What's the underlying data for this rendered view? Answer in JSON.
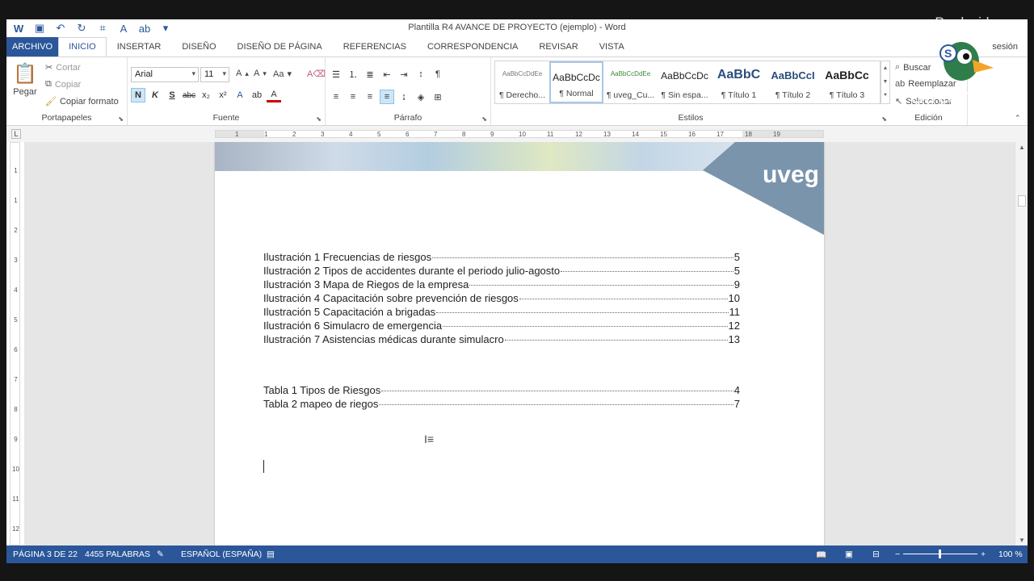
{
  "window_title": "Plantilla R4 AVANCE DE PROYECTO (ejemplo) - Word",
  "sign_in": "sesión",
  "tabs": [
    "ARCHIVO",
    "INICIO",
    "INSERTAR",
    "DISEÑO",
    "DISEÑO DE PÁGINA",
    "REFERENCIAS",
    "CORRESPONDENCIA",
    "REVISAR",
    "VISTA"
  ],
  "active_tab": "INICIO",
  "clipboard": {
    "paste": "Pegar",
    "cut": "Cortar",
    "copy": "Copiar",
    "format_painter": "Copiar formato",
    "label": "Portapapeles"
  },
  "font": {
    "name": "Arial",
    "size": "11",
    "case": "Aa",
    "bold": "N",
    "italic": "K",
    "underline": "S",
    "strike": "abc",
    "sub": "x₂",
    "sup": "x²",
    "label": "Fuente"
  },
  "paragraph": {
    "label": "Párrafo"
  },
  "styles": {
    "label": "Estilos",
    "items": [
      {
        "preview": "AaBbCcDdEe",
        "name": "¶ Derecho..."
      },
      {
        "preview": "AaBbCcDc",
        "name": "¶ Normal"
      },
      {
        "preview": "AaBbCcDdEe",
        "name": "¶ uveg_Cu..."
      },
      {
        "preview": "AaBbCcDc",
        "name": "¶ Sin espa..."
      },
      {
        "preview": "AaBbC",
        "name": "¶ Título 1"
      },
      {
        "preview": "AaBbCcI",
        "name": "¶ Título 2"
      },
      {
        "preview": "AaBbCc",
        "name": "¶ Título 3"
      }
    ]
  },
  "editing": {
    "find": "Buscar",
    "replace": "Reemplazar",
    "select": "Seleccionar",
    "label": "Edición"
  },
  "ruler_numbers": [
    "1",
    "1",
    "2",
    "3",
    "4",
    "5",
    "6",
    "7",
    "8",
    "9",
    "10",
    "11",
    "12",
    "13",
    "14",
    "15",
    "16",
    "17",
    "18",
    "19"
  ],
  "vruler_numbers": [
    "1",
    "1",
    "2",
    "3",
    "4",
    "5",
    "6",
    "7",
    "8",
    "9",
    "10",
    "11",
    "12"
  ],
  "logo_text": "uveg",
  "illustrations": [
    {
      "text": "Ilustración 1 Frecuencias de riesgos",
      "page": "5"
    },
    {
      "text": "Ilustración 2 Tipos de accidentes durante el periodo julio-agosto",
      "page": "5"
    },
    {
      "text": "Ilustración 3 Mapa de Riegos de la empresa",
      "page": "9"
    },
    {
      "text": "Ilustración 4 Capacitación sobre prevención de riesgos",
      "page": "10"
    },
    {
      "text": "Ilustración 5 Capacitación a brigadas",
      "page": "11"
    },
    {
      "text": "Ilustración 6 Simulacro de emergencia",
      "page": "12"
    },
    {
      "text": "Ilustración 7 Asistencias médicas durante simulacro",
      "page": "13"
    }
  ],
  "tables": [
    {
      "text": "Tabla 1  Tipos de Riesgos",
      "page": "4"
    },
    {
      "text": "Tabla 2 mapeo de riegos",
      "page": "7"
    }
  ],
  "status": {
    "page": "PÁGINA 3 DE 22",
    "words": "4455 PALABRAS",
    "language": "ESPAÑOL (ESPAÑA)",
    "zoom": "100 %"
  },
  "overlay": {
    "producido": "Producido con",
    "streamyard": "StreamYard"
  },
  "colors": {
    "accent": "#2b579a"
  }
}
